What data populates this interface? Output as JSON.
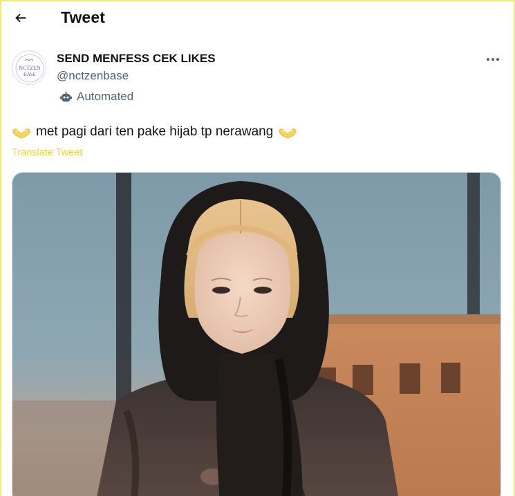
{
  "header": {
    "title": "Tweet",
    "back_icon": "arrow-left-icon"
  },
  "author": {
    "display_name": "SEND MENFESS CEK LIKES",
    "handle": "@nctzenbase",
    "avatar_text_top": "NCTZEN",
    "avatar_text_bottom": "BASE",
    "badge_icon": "robot-icon",
    "badge_label": "Automated"
  },
  "tweet": {
    "text": "met pagi dari ten pake hijab tp nerawang",
    "leading_emoji": "heart-hands-emoji",
    "trailing_emoji": "heart-hands-emoji",
    "translate_label": "Translate Tweet",
    "more_icon": "more-horizontal-icon"
  },
  "colors": {
    "frame_border": "#f5ec5f",
    "translate_link": "#f5d22a",
    "secondary_text": "#536471",
    "primary_text": "#0f1419"
  }
}
